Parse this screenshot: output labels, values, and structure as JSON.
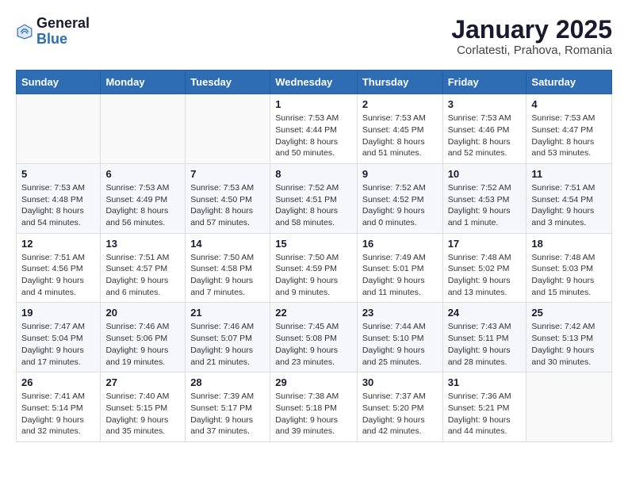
{
  "header": {
    "logo_general": "General",
    "logo_blue": "Blue",
    "month_title": "January 2025",
    "location": "Corlatesti, Prahova, Romania"
  },
  "weekdays": [
    "Sunday",
    "Monday",
    "Tuesday",
    "Wednesday",
    "Thursday",
    "Friday",
    "Saturday"
  ],
  "weeks": [
    [
      {
        "day": "",
        "info": ""
      },
      {
        "day": "",
        "info": ""
      },
      {
        "day": "",
        "info": ""
      },
      {
        "day": "1",
        "info": "Sunrise: 7:53 AM\nSunset: 4:44 PM\nDaylight: 8 hours\nand 50 minutes."
      },
      {
        "day": "2",
        "info": "Sunrise: 7:53 AM\nSunset: 4:45 PM\nDaylight: 8 hours\nand 51 minutes."
      },
      {
        "day": "3",
        "info": "Sunrise: 7:53 AM\nSunset: 4:46 PM\nDaylight: 8 hours\nand 52 minutes."
      },
      {
        "day": "4",
        "info": "Sunrise: 7:53 AM\nSunset: 4:47 PM\nDaylight: 8 hours\nand 53 minutes."
      }
    ],
    [
      {
        "day": "5",
        "info": "Sunrise: 7:53 AM\nSunset: 4:48 PM\nDaylight: 8 hours\nand 54 minutes."
      },
      {
        "day": "6",
        "info": "Sunrise: 7:53 AM\nSunset: 4:49 PM\nDaylight: 8 hours\nand 56 minutes."
      },
      {
        "day": "7",
        "info": "Sunrise: 7:53 AM\nSunset: 4:50 PM\nDaylight: 8 hours\nand 57 minutes."
      },
      {
        "day": "8",
        "info": "Sunrise: 7:52 AM\nSunset: 4:51 PM\nDaylight: 8 hours\nand 58 minutes."
      },
      {
        "day": "9",
        "info": "Sunrise: 7:52 AM\nSunset: 4:52 PM\nDaylight: 9 hours\nand 0 minutes."
      },
      {
        "day": "10",
        "info": "Sunrise: 7:52 AM\nSunset: 4:53 PM\nDaylight: 9 hours\nand 1 minute."
      },
      {
        "day": "11",
        "info": "Sunrise: 7:51 AM\nSunset: 4:54 PM\nDaylight: 9 hours\nand 3 minutes."
      }
    ],
    [
      {
        "day": "12",
        "info": "Sunrise: 7:51 AM\nSunset: 4:56 PM\nDaylight: 9 hours\nand 4 minutes."
      },
      {
        "day": "13",
        "info": "Sunrise: 7:51 AM\nSunset: 4:57 PM\nDaylight: 9 hours\nand 6 minutes."
      },
      {
        "day": "14",
        "info": "Sunrise: 7:50 AM\nSunset: 4:58 PM\nDaylight: 9 hours\nand 7 minutes."
      },
      {
        "day": "15",
        "info": "Sunrise: 7:50 AM\nSunset: 4:59 PM\nDaylight: 9 hours\nand 9 minutes."
      },
      {
        "day": "16",
        "info": "Sunrise: 7:49 AM\nSunset: 5:01 PM\nDaylight: 9 hours\nand 11 minutes."
      },
      {
        "day": "17",
        "info": "Sunrise: 7:48 AM\nSunset: 5:02 PM\nDaylight: 9 hours\nand 13 minutes."
      },
      {
        "day": "18",
        "info": "Sunrise: 7:48 AM\nSunset: 5:03 PM\nDaylight: 9 hours\nand 15 minutes."
      }
    ],
    [
      {
        "day": "19",
        "info": "Sunrise: 7:47 AM\nSunset: 5:04 PM\nDaylight: 9 hours\nand 17 minutes."
      },
      {
        "day": "20",
        "info": "Sunrise: 7:46 AM\nSunset: 5:06 PM\nDaylight: 9 hours\nand 19 minutes."
      },
      {
        "day": "21",
        "info": "Sunrise: 7:46 AM\nSunset: 5:07 PM\nDaylight: 9 hours\nand 21 minutes."
      },
      {
        "day": "22",
        "info": "Sunrise: 7:45 AM\nSunset: 5:08 PM\nDaylight: 9 hours\nand 23 minutes."
      },
      {
        "day": "23",
        "info": "Sunrise: 7:44 AM\nSunset: 5:10 PM\nDaylight: 9 hours\nand 25 minutes."
      },
      {
        "day": "24",
        "info": "Sunrise: 7:43 AM\nSunset: 5:11 PM\nDaylight: 9 hours\nand 28 minutes."
      },
      {
        "day": "25",
        "info": "Sunrise: 7:42 AM\nSunset: 5:13 PM\nDaylight: 9 hours\nand 30 minutes."
      }
    ],
    [
      {
        "day": "26",
        "info": "Sunrise: 7:41 AM\nSunset: 5:14 PM\nDaylight: 9 hours\nand 32 minutes."
      },
      {
        "day": "27",
        "info": "Sunrise: 7:40 AM\nSunset: 5:15 PM\nDaylight: 9 hours\nand 35 minutes."
      },
      {
        "day": "28",
        "info": "Sunrise: 7:39 AM\nSunset: 5:17 PM\nDaylight: 9 hours\nand 37 minutes."
      },
      {
        "day": "29",
        "info": "Sunrise: 7:38 AM\nSunset: 5:18 PM\nDaylight: 9 hours\nand 39 minutes."
      },
      {
        "day": "30",
        "info": "Sunrise: 7:37 AM\nSunset: 5:20 PM\nDaylight: 9 hours\nand 42 minutes."
      },
      {
        "day": "31",
        "info": "Sunrise: 7:36 AM\nSunset: 5:21 PM\nDaylight: 9 hours\nand 44 minutes."
      },
      {
        "day": "",
        "info": ""
      }
    ]
  ]
}
